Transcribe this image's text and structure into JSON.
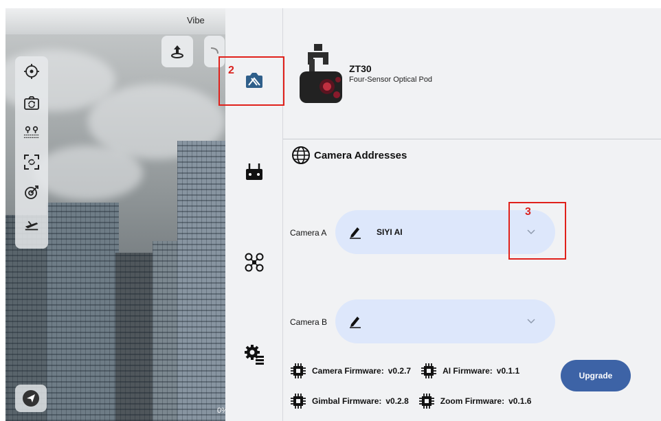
{
  "feed": {
    "title": "Vibe",
    "zoom_text": "0%",
    "icons": [
      "recenter-icon",
      "camera-switch-icon",
      "waypoint-icon",
      "focus-frame-icon",
      "target-track-icon",
      "landing-icon",
      "send-icon",
      "upload-icon"
    ]
  },
  "annotations": {
    "nav_marker": "2",
    "dropdown_marker": "3",
    "color": "#e0201a"
  },
  "nav": {
    "items": [
      {
        "name": "gimbal-camera",
        "icon": "gimbal-camera-icon",
        "active": true
      },
      {
        "name": "remote-controller",
        "icon": "remote-controller-icon"
      },
      {
        "name": "aircraft",
        "icon": "drone-icon"
      },
      {
        "name": "system-settings",
        "icon": "settings-gear-icon"
      }
    ]
  },
  "device": {
    "name": "ZT30",
    "description": "Four-Sensor Optical Pod"
  },
  "camera_addresses": {
    "title": "Camera Addresses",
    "camera_a": {
      "label": "Camera A",
      "value": "SIYI AI"
    },
    "camera_b": {
      "label": "Camera B",
      "value": ""
    }
  },
  "firmware": {
    "camera_label": "Camera Firmware:",
    "camera_version": "v0.2.7",
    "ai_label": "AI Firmware:",
    "ai_version": "v0.1.1",
    "gimbal_label": "Gimbal Firmware:",
    "gimbal_version": "v0.2.8",
    "zoom_label": "Zoom Firmware:",
    "zoom_version": "v0.1.6",
    "upgrade_label": "Upgrade"
  },
  "colors": {
    "accent": "#3d63a6",
    "select_bg": "#dde7fb",
    "panel_bg": "#f1f2f4"
  }
}
